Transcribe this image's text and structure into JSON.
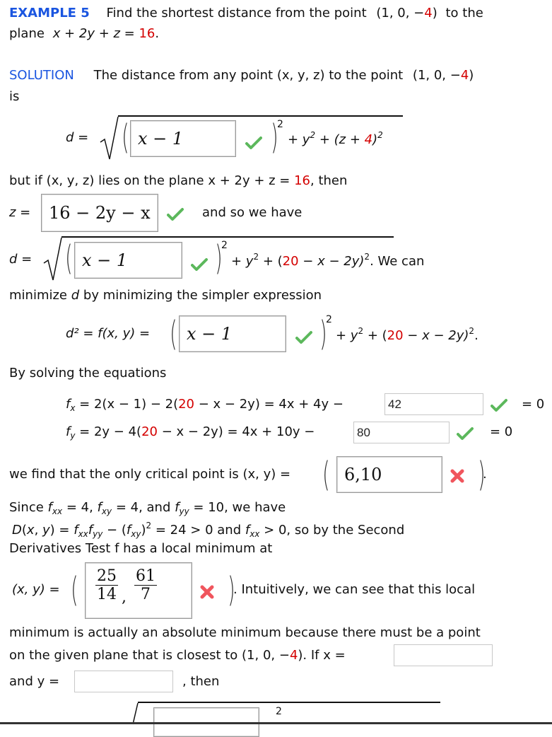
{
  "header": {
    "example_label": "EXAMPLE 5",
    "problem_text_1": "Find the shortest distance from the point",
    "point": "(1, 0, −",
    "point_red": "4",
    "point_close": ")",
    "to_the": "to the",
    "plane_label": "plane",
    "plane_eq": "x + 2y + z = ",
    "plane_rhs": "16",
    "period": "."
  },
  "solution": {
    "label": "SOLUTION",
    "text_1": "The distance from any point (x, y, z) to the point",
    "point": "(1, 0, −",
    "point_red": "4",
    "point_close": ")",
    "is": "is"
  },
  "eq1": {
    "lhs": "d =",
    "box_value": "x − 1",
    "box_status": "correct",
    "exp": "2",
    "rest_1": "+ y",
    "rest_exp": "2",
    "rest_2": "+ (z + ",
    "rest_red": "4",
    "rest_3": ")",
    "rest_exp2": "2"
  },
  "line2": {
    "text": "but if (x, y, z) lies on the plane x + 2y + z = ",
    "red": "16",
    "tail": ", then"
  },
  "eq2": {
    "lhs": "z =",
    "box_value": "16 − 2y − x",
    "box_status": "correct",
    "tail": "and so we have"
  },
  "eq3": {
    "lhs": "d =",
    "box_value": "x − 1",
    "box_status": "correct",
    "exp": "2",
    "rest_1": "+ y",
    "rest_exp": "2",
    "rest_2": "+ (",
    "rest_red": "20",
    "rest_3": " − x − 2y)",
    "rest_exp2": "2",
    "tail": ".  We can"
  },
  "line4": {
    "text_1": "minimize ",
    "d": "d",
    "text_2": " by minimizing the simpler expression"
  },
  "eq4": {
    "lhs": "d² = f(x, y) =",
    "box_value": "x − 1",
    "box_status": "correct",
    "exp": "2",
    "rest_1": "+ y",
    "rest_exp": "2",
    "rest_2": "+ (",
    "rest_red": "20",
    "rest_3": " − x − 2y)",
    "rest_exp2": "2",
    "tail": "."
  },
  "line5": {
    "text": "By solving the equations"
  },
  "fx": {
    "label": "f",
    "sub": "x",
    "eq_1": " =  2(x − 1) − 2(",
    "red": "20",
    "eq_2": " − x − 2y) = 4x + 4y −",
    "input_value": "42",
    "status": "correct",
    "tail": "= 0"
  },
  "fy": {
    "label": "f",
    "sub": "y",
    "eq_1": " =  2y − 4(",
    "red": "20",
    "eq_2": " − x − 2y) = 4x + 10y −",
    "input_value": "80",
    "status": "correct",
    "tail": "= 0"
  },
  "critical": {
    "text": "we find that the only critical point is  (x, y) =",
    "box_value": "6,10",
    "box_status": "incorrect",
    "tail": "."
  },
  "second": {
    "line1": "Since  f",
    "line2": "D(x, y) = f",
    "line3": "Derivatives Test f has a local minimum at",
    "fxx": "= 4,",
    "fxy": "= 4,  and",
    "fyy": "= 10,  we have",
    "d_expr": "= 24 > 0  and",
    "d_tail": "> 0,  so by the Second"
  },
  "localmin": {
    "lhs": "(x, y) =",
    "frac1_num": "25",
    "frac1_den": "14",
    "frac2_num": "61",
    "frac2_den": "7",
    "box_status": "incorrect",
    "tail": ".  Intuitively, we can see that this local"
  },
  "closing": {
    "line1": "minimum is actually an absolute minimum because there must be a point",
    "line2_a": "on the given plane that is closest to  (1, 0, −",
    "line2_red": "4",
    "line2_b": ").  If  x =",
    "x_value": "",
    "line3_a": "and  y =",
    "y_value": "",
    "line3_b": ",  then"
  },
  "status_colors": {
    "correct": "#5cb85c",
    "incorrect": "#f0555d",
    "accent": "#1a55e0",
    "given": "#d40000"
  }
}
